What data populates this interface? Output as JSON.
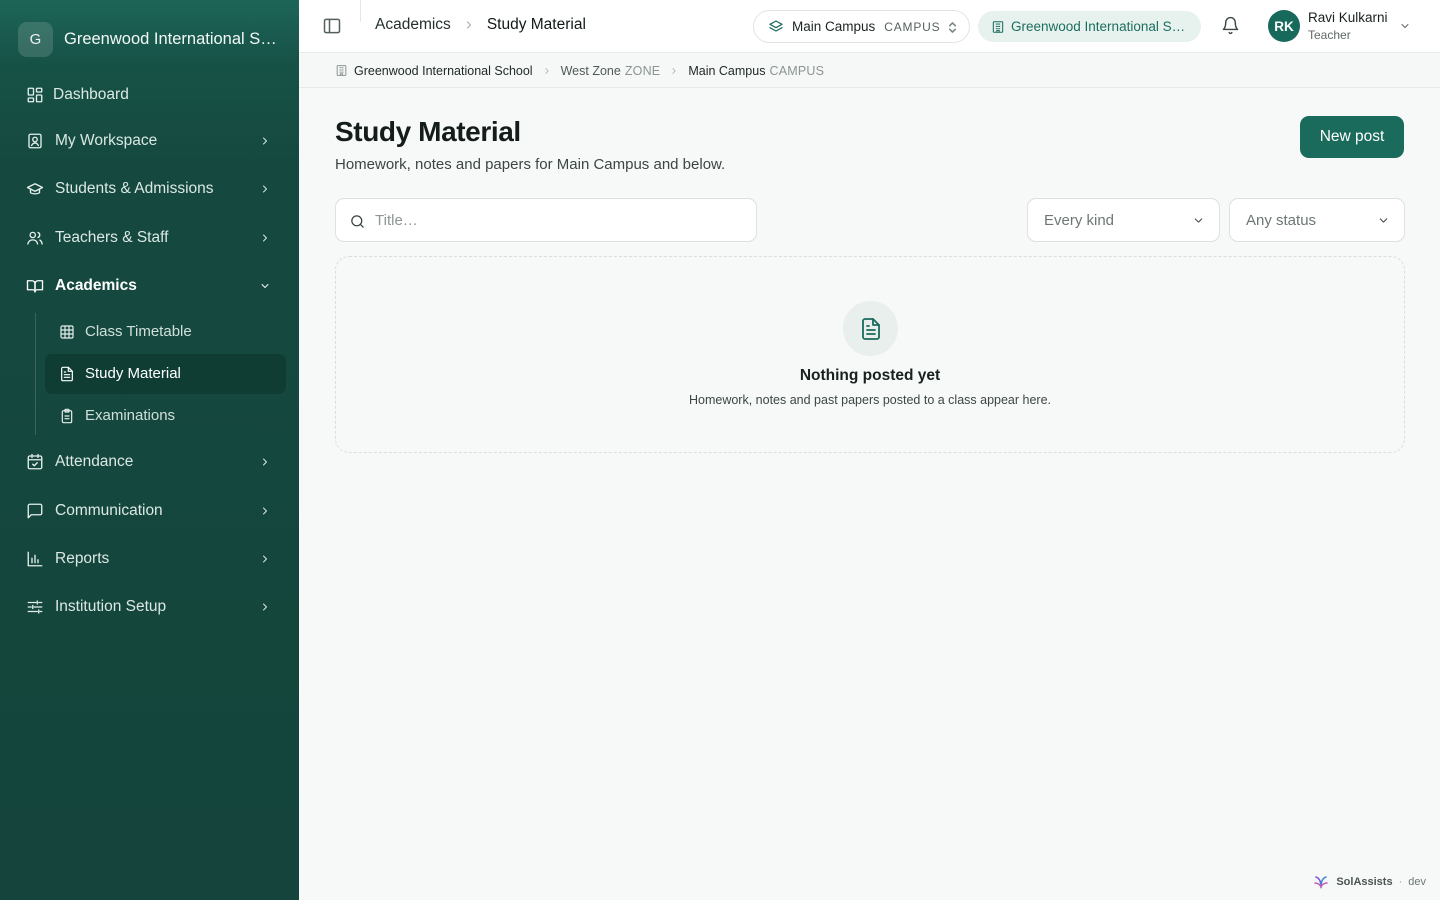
{
  "sidebar": {
    "brand": {
      "initial": "G",
      "name": "Greenwood International School"
    },
    "nav": [
      {
        "label": "Dashboard"
      },
      {
        "label": "My Workspace"
      },
      {
        "label": "Students & Admissions"
      },
      {
        "label": "Teachers & Staff"
      },
      {
        "label": "Academics",
        "expanded": true
      },
      {
        "label": "Attendance"
      },
      {
        "label": "Communication"
      },
      {
        "label": "Reports"
      },
      {
        "label": "Institution Setup"
      }
    ],
    "academics_children": [
      {
        "label": "Class Timetable"
      },
      {
        "label": "Study Material",
        "active": true
      },
      {
        "label": "Examinations"
      }
    ]
  },
  "topbar": {
    "breadcrumb": [
      "Academics",
      "Study Material"
    ],
    "campus": {
      "name": "Main Campus",
      "tag": "CAMPUS"
    },
    "school": "Greenwood International School",
    "user": {
      "initials": "RK",
      "name": "Ravi Kulkarni",
      "role": "Teacher"
    }
  },
  "context": {
    "school": "Greenwood International School",
    "zone": {
      "name": "West Zone",
      "tag": "ZONE"
    },
    "campus": {
      "name": "Main Campus",
      "tag": "CAMPUS"
    }
  },
  "main": {
    "title": "Study Material",
    "subtitle": "Homework, notes and papers for Main Campus and below.",
    "new_post_label": "New post",
    "search_placeholder": "Title…",
    "kind_filter": "Every kind",
    "status_filter": "Any status",
    "empty": {
      "title": "Nothing posted yet",
      "message": "Homework, notes and past papers posted to a class appear here."
    }
  },
  "footer": {
    "brand": "SolAssists",
    "separator": "·",
    "env": "dev"
  },
  "colors": {
    "sidebar": "#14443b",
    "accent": "#1a6b5c",
    "active_sub": "#0f3d34"
  }
}
